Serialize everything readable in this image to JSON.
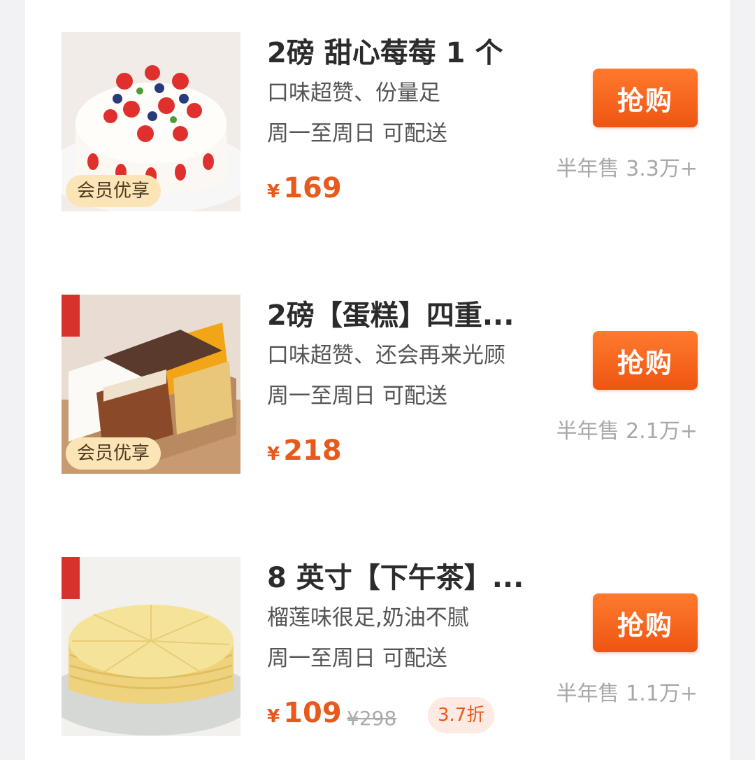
{
  "products": [
    {
      "title": "2磅 甜心莓莓 1 个",
      "desc": "口味超赞、份量足",
      "delivery": "周一至周日  可配送",
      "badge": "会员优享",
      "currency": "¥",
      "price": "169",
      "buy_label": "抢购",
      "sold": "半年售 3.3万+"
    },
    {
      "title": "2磅【蛋糕】四重...",
      "desc": "口味超赞、还会再来光顾",
      "delivery": "周一至周日  可配送",
      "badge": "会员优享",
      "currency": "¥",
      "price": "218",
      "buy_label": "抢购",
      "sold": "半年售 2.1万+"
    },
    {
      "title": "8 英寸【下午茶】...",
      "desc": "榴莲味很足,奶油不腻",
      "delivery": "周一至周日  可配送",
      "currency": "¥",
      "price": "109",
      "original_price": "¥298",
      "discount": "3.7折",
      "buy_label": "抢购",
      "sold": "半年售 1.1万+"
    }
  ],
  "colors": {
    "accent": "#ee5512",
    "badge_bg": "#fbe4b6",
    "muted": "#a8a8a8"
  }
}
